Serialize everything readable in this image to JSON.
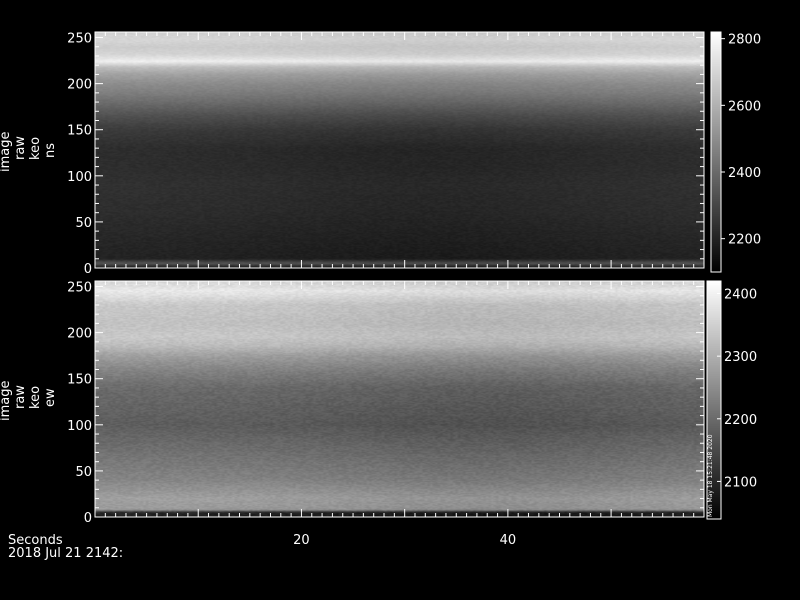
{
  "chart_data": [
    {
      "type": "heatmap",
      "name": "keo-ns",
      "ylabel_lines": [
        "image",
        "raw",
        "keo",
        "ns"
      ],
      "ylim": [
        0,
        256
      ],
      "yticks": [
        0,
        50,
        100,
        150,
        200,
        250
      ],
      "xlim": [
        0,
        59
      ],
      "xticks": [
        20,
        40
      ],
      "colorbar": {
        "range": [
          2100,
          2820
        ],
        "ticks": [
          2200,
          2400,
          2600,
          2800
        ]
      },
      "profile_y": [
        0,
        5,
        10,
        30,
        60,
        90,
        110,
        130,
        150,
        165,
        180,
        190,
        200,
        210,
        218,
        224,
        232,
        240,
        248,
        256
      ],
      "profile_v": [
        2160,
        2350,
        2200,
        2210,
        2230,
        2240,
        2230,
        2230,
        2270,
        2330,
        2410,
        2460,
        2500,
        2560,
        2640,
        2780,
        2700,
        2680,
        2710,
        2690
      ],
      "time_variation": {
        "amplitude": 25,
        "dip_center": 32
      }
    },
    {
      "type": "heatmap",
      "name": "keo-ew",
      "ylabel_lines": [
        "image",
        "raw",
        "keo",
        "ew"
      ],
      "ylim": [
        0,
        256
      ],
      "yticks": [
        0,
        50,
        100,
        150,
        200,
        250
      ],
      "xlim": [
        0,
        59
      ],
      "xticks": [
        20,
        40
      ],
      "colorbar": {
        "range": [
          2040,
          2420
        ],
        "ticks": [
          2100,
          2200,
          2300,
          2400
        ]
      },
      "profile_y": [
        0,
        5,
        8,
        20,
        40,
        60,
        80,
        100,
        120,
        140,
        160,
        175,
        185,
        195,
        210,
        230,
        245,
        256
      ],
      "profile_v": [
        2080,
        2100,
        2270,
        2280,
        2240,
        2220,
        2200,
        2180,
        2190,
        2200,
        2240,
        2280,
        2320,
        2340,
        2330,
        2340,
        2390,
        2360
      ],
      "time_variation": {
        "amplitude": 20,
        "dip_center": 38
      }
    }
  ],
  "footer": {
    "xaxis_title": "Seconds",
    "date_line": "2018 Jul 21 2142:",
    "side_stamp": "Mon May 18 15:21:48 2020"
  }
}
